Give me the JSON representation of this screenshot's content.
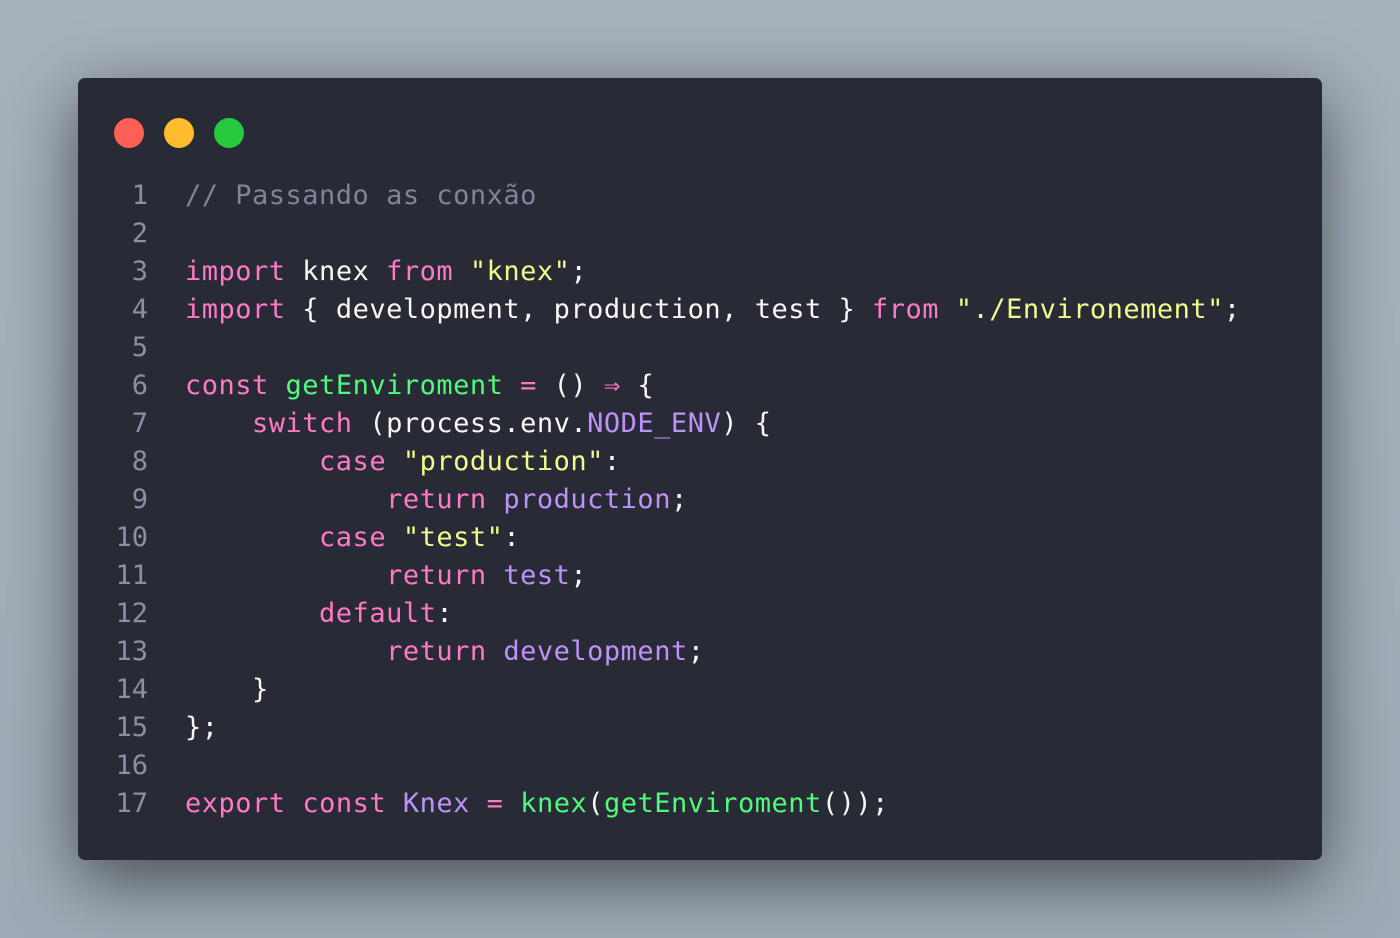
{
  "window": {
    "controls": [
      {
        "name": "close",
        "color": "#ff5f56"
      },
      {
        "name": "minimize",
        "color": "#ffbd2e"
      },
      {
        "name": "zoom",
        "color": "#27c93f"
      }
    ]
  },
  "colors": {
    "background": "#282a36",
    "foreground": "#f8f8f2",
    "comment": "#7f8499",
    "keyword": "#ff79c6",
    "string": "#f1fa8c",
    "function": "#50fa7b",
    "constant": "#bd93f9",
    "line_number": "#8a8fa3"
  },
  "code_lines": [
    {
      "n": "1",
      "tokens": [
        {
          "t": "// Passando as conxão",
          "c": "comment"
        }
      ]
    },
    {
      "n": "2",
      "tokens": []
    },
    {
      "n": "3",
      "tokens": [
        {
          "t": "import",
          "c": "keyword"
        },
        {
          "t": " knex ",
          "c": "plain"
        },
        {
          "t": "from",
          "c": "keyword"
        },
        {
          "t": " ",
          "c": "plain"
        },
        {
          "t": "\"knex\"",
          "c": "string"
        },
        {
          "t": ";",
          "c": "plain"
        }
      ]
    },
    {
      "n": "4",
      "tokens": [
        {
          "t": "import",
          "c": "keyword"
        },
        {
          "t": " { development, production, test } ",
          "c": "plain"
        },
        {
          "t": "from",
          "c": "keyword"
        },
        {
          "t": " ",
          "c": "plain"
        },
        {
          "t": "\"./Environement\"",
          "c": "string"
        },
        {
          "t": ";",
          "c": "plain"
        }
      ]
    },
    {
      "n": "5",
      "tokens": []
    },
    {
      "n": "6",
      "tokens": [
        {
          "t": "const",
          "c": "keyword"
        },
        {
          "t": " ",
          "c": "plain"
        },
        {
          "t": "getEnviroment",
          "c": "function"
        },
        {
          "t": " ",
          "c": "plain"
        },
        {
          "t": "=",
          "c": "keyword"
        },
        {
          "t": " () ",
          "c": "plain"
        },
        {
          "t": "⇒",
          "c": "keyword"
        },
        {
          "t": " {",
          "c": "plain"
        }
      ]
    },
    {
      "n": "7",
      "tokens": [
        {
          "t": "    ",
          "c": "plain"
        },
        {
          "t": "switch",
          "c": "keyword"
        },
        {
          "t": " (process.env.",
          "c": "plain"
        },
        {
          "t": "NODE_ENV",
          "c": "constant"
        },
        {
          "t": ") {",
          "c": "plain"
        }
      ]
    },
    {
      "n": "8",
      "tokens": [
        {
          "t": "        ",
          "c": "plain"
        },
        {
          "t": "case",
          "c": "keyword"
        },
        {
          "t": " ",
          "c": "plain"
        },
        {
          "t": "\"production\"",
          "c": "string"
        },
        {
          "t": ":",
          "c": "plain"
        }
      ]
    },
    {
      "n": "9",
      "tokens": [
        {
          "t": "            ",
          "c": "plain"
        },
        {
          "t": "return",
          "c": "keyword"
        },
        {
          "t": " ",
          "c": "plain"
        },
        {
          "t": "production",
          "c": "constant"
        },
        {
          "t": ";",
          "c": "plain"
        }
      ]
    },
    {
      "n": "10",
      "tokens": [
        {
          "t": "        ",
          "c": "plain"
        },
        {
          "t": "case",
          "c": "keyword"
        },
        {
          "t": " ",
          "c": "plain"
        },
        {
          "t": "\"test\"",
          "c": "string"
        },
        {
          "t": ":",
          "c": "plain"
        }
      ]
    },
    {
      "n": "11",
      "tokens": [
        {
          "t": "            ",
          "c": "plain"
        },
        {
          "t": "return",
          "c": "keyword"
        },
        {
          "t": " ",
          "c": "plain"
        },
        {
          "t": "test",
          "c": "constant"
        },
        {
          "t": ";",
          "c": "plain"
        }
      ]
    },
    {
      "n": "12",
      "tokens": [
        {
          "t": "        ",
          "c": "plain"
        },
        {
          "t": "default",
          "c": "keyword"
        },
        {
          "t": ":",
          "c": "plain"
        }
      ]
    },
    {
      "n": "13",
      "tokens": [
        {
          "t": "            ",
          "c": "plain"
        },
        {
          "t": "return",
          "c": "keyword"
        },
        {
          "t": " ",
          "c": "plain"
        },
        {
          "t": "development",
          "c": "constant"
        },
        {
          "t": ";",
          "c": "plain"
        }
      ]
    },
    {
      "n": "14",
      "tokens": [
        {
          "t": "    }",
          "c": "plain"
        }
      ]
    },
    {
      "n": "15",
      "tokens": [
        {
          "t": "};",
          "c": "plain"
        }
      ]
    },
    {
      "n": "16",
      "tokens": []
    },
    {
      "n": "17",
      "tokens": [
        {
          "t": "export",
          "c": "keyword"
        },
        {
          "t": " ",
          "c": "plain"
        },
        {
          "t": "const",
          "c": "keyword"
        },
        {
          "t": " ",
          "c": "plain"
        },
        {
          "t": "Knex",
          "c": "constant"
        },
        {
          "t": " ",
          "c": "plain"
        },
        {
          "t": "=",
          "c": "keyword"
        },
        {
          "t": " ",
          "c": "plain"
        },
        {
          "t": "knex",
          "c": "function"
        },
        {
          "t": "(",
          "c": "plain"
        },
        {
          "t": "getEnviroment",
          "c": "function"
        },
        {
          "t": "());",
          "c": "plain"
        }
      ]
    }
  ]
}
